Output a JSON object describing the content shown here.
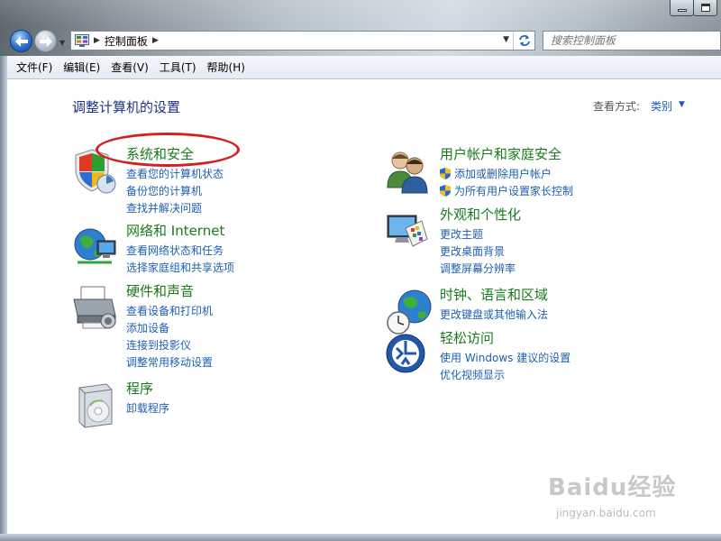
{
  "addressbar": {
    "path": [
      "控制面板"
    ]
  },
  "search": {
    "placeholder": "搜索控制面板"
  },
  "menu": [
    "文件(F)",
    "编辑(E)",
    "查看(V)",
    "工具(T)",
    "帮助(H)"
  ],
  "header": {
    "title": "调整计算机的设置",
    "view_label": "查看方式:",
    "view_value": "类别"
  },
  "categories": [
    {
      "title": "系统和安全",
      "links": [
        "查看您的计算机状态",
        "备份您的计算机",
        "查找并解决问题"
      ],
      "icon": "shield-icon"
    },
    {
      "title": "网络和 Internet",
      "links": [
        "查看网络状态和任务",
        "选择家庭组和共享选项"
      ],
      "icon": "network-globe-icon"
    },
    {
      "title": "硬件和声音",
      "links": [
        "查看设备和打印机",
        "添加设备",
        "连接到投影仪",
        "调整常用移动设置"
      ],
      "icon": "printer-icon"
    },
    {
      "title": "程序",
      "links": [
        "卸载程序"
      ],
      "icon": "programs-icon"
    },
    {
      "title": "用户帐户和家庭安全",
      "links": [
        "添加或删除用户帐户",
        "为所有用户设置家长控制"
      ],
      "icon": "users-icon"
    },
    {
      "title": "外观和个性化",
      "links": [
        "更改主题",
        "更改桌面背景",
        "调整屏幕分辨率"
      ],
      "icon": "display-palette-icon"
    },
    {
      "title": "时钟、语言和区域",
      "links": [
        "更改键盘或其他输入法"
      ],
      "icon": "clock-globe-icon"
    },
    {
      "title": "轻松访问",
      "links": [
        "使用 Windows 建议的设置",
        "优化视频显示"
      ],
      "icon": "ease-of-access-icon"
    }
  ],
  "watermark": {
    "brand": "Baidu经验",
    "url": "jingyan.baidu.com"
  },
  "colors": {
    "category_title": "#197b1c",
    "link": "#1e5fb4",
    "page_title": "#1e3287",
    "highlight_oval": "#d42020"
  }
}
